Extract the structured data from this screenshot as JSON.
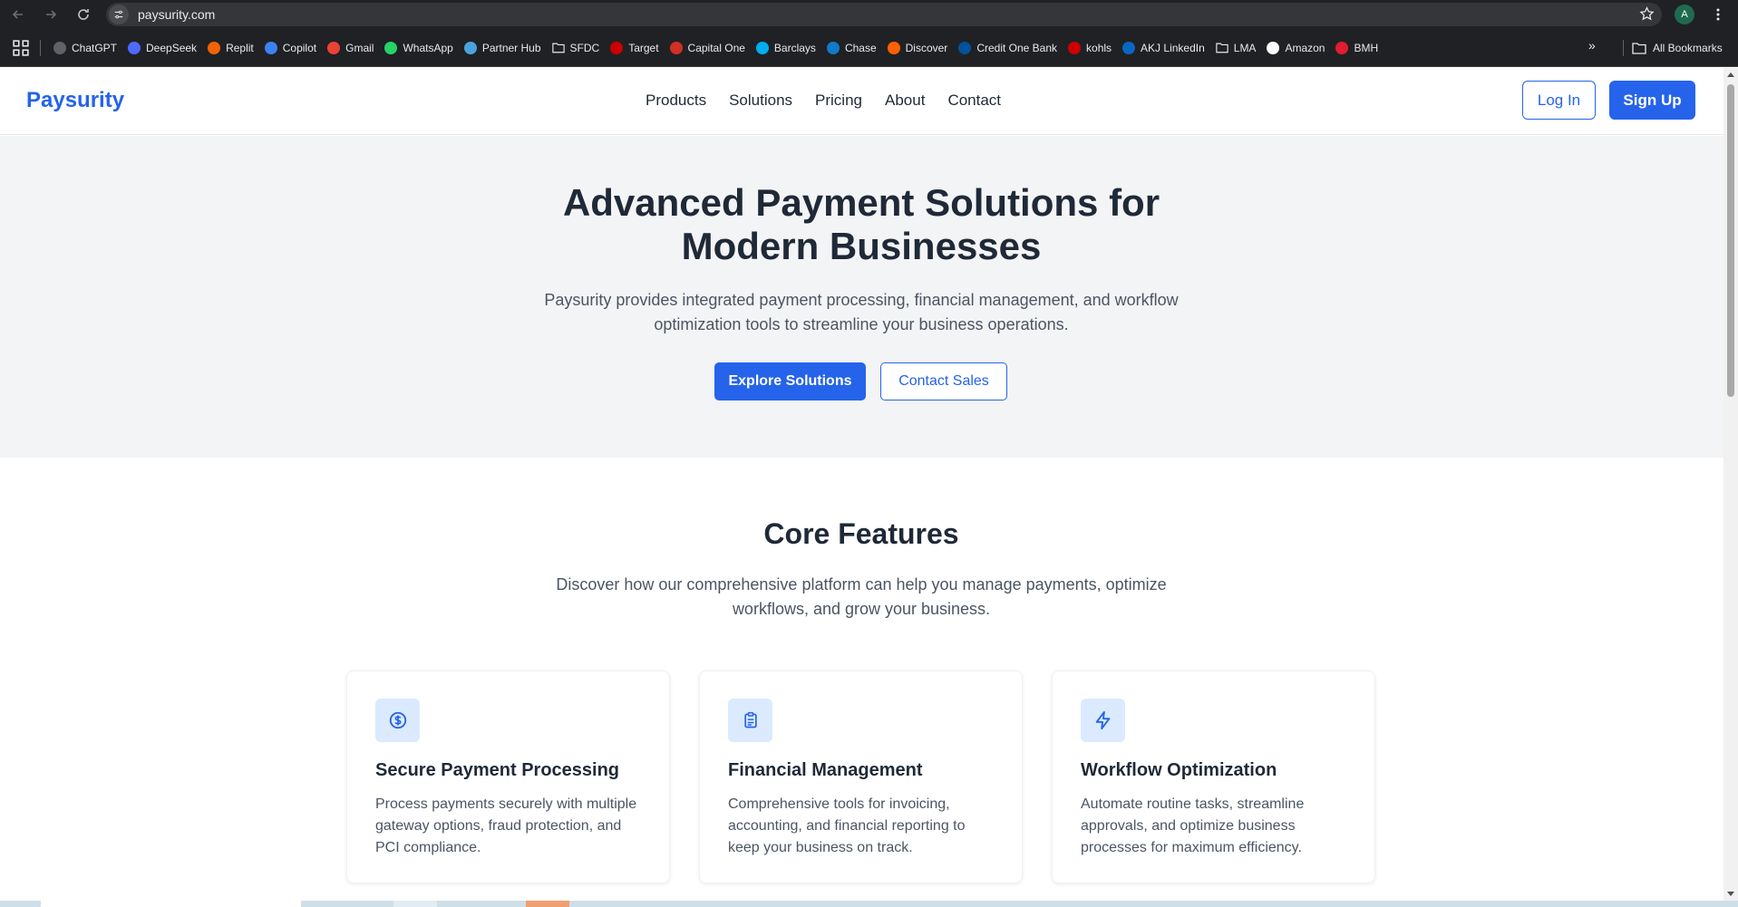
{
  "browser": {
    "url": "paysurity.com",
    "profile_initial": "A",
    "bookmarks": [
      {
        "label": "ChatGPT",
        "color": "#5f6368"
      },
      {
        "label": "DeepSeek",
        "color": "#4d6bfe"
      },
      {
        "label": "Replit",
        "color": "#f26207"
      },
      {
        "label": "Copilot",
        "color": "#3b82f6"
      },
      {
        "label": "Gmail",
        "color": "#ea4335"
      },
      {
        "label": "WhatsApp",
        "color": "#25d366"
      },
      {
        "label": "Partner Hub",
        "color": "#4aa3df"
      },
      {
        "label": "SFDC",
        "color": "folder"
      },
      {
        "label": "Target",
        "color": "#cc0000"
      },
      {
        "label": "Capital One",
        "color": "#d03027"
      },
      {
        "label": "Barclays",
        "color": "#00aeef"
      },
      {
        "label": "Chase",
        "color": "#117aca"
      },
      {
        "label": "Discover",
        "color": "#ff6000"
      },
      {
        "label": "Credit One Bank",
        "color": "#00539b"
      },
      {
        "label": "kohls",
        "color": "#cc0000"
      },
      {
        "label": "AKJ LinkedIn",
        "color": "#0a66c2"
      },
      {
        "label": "LMA",
        "color": "folder"
      },
      {
        "label": "Amazon",
        "color": "#ffffff"
      },
      {
        "label": "BMH",
        "color": "#e11d2e"
      }
    ],
    "all_bookmarks_label": "All Bookmarks"
  },
  "header": {
    "logo": "Paysurity",
    "nav": [
      "Products",
      "Solutions",
      "Pricing",
      "About",
      "Contact"
    ],
    "login_label": "Log In",
    "signup_label": "Sign Up"
  },
  "hero": {
    "title": "Advanced Payment Solutions for Modern Businesses",
    "subtitle": "Paysurity provides integrated payment processing, financial management, and workflow optimization tools to streamline your business operations.",
    "primary_cta": "Explore Solutions",
    "secondary_cta": "Contact Sales"
  },
  "features": {
    "title": "Core Features",
    "subtitle": "Discover how our comprehensive platform can help you manage payments, optimize workflows, and grow your business.",
    "cards": [
      {
        "icon": "dollar-circle-icon",
        "title": "Secure Payment Processing",
        "description": "Process payments securely with multiple gateway options, fraud protection, and PCI compliance."
      },
      {
        "icon": "clipboard-icon",
        "title": "Financial Management",
        "description": "Comprehensive tools for invoicing, accounting, and financial reporting to keep your business on track."
      },
      {
        "icon": "lightning-icon",
        "title": "Workflow Optimization",
        "description": "Automate routine tasks, streamline approvals, and optimize business processes for maximum efficiency."
      }
    ]
  },
  "colors": {
    "brand": "#2563eb",
    "hero_bg": "#f3f4f6",
    "icon_bg": "#dbeafe"
  }
}
